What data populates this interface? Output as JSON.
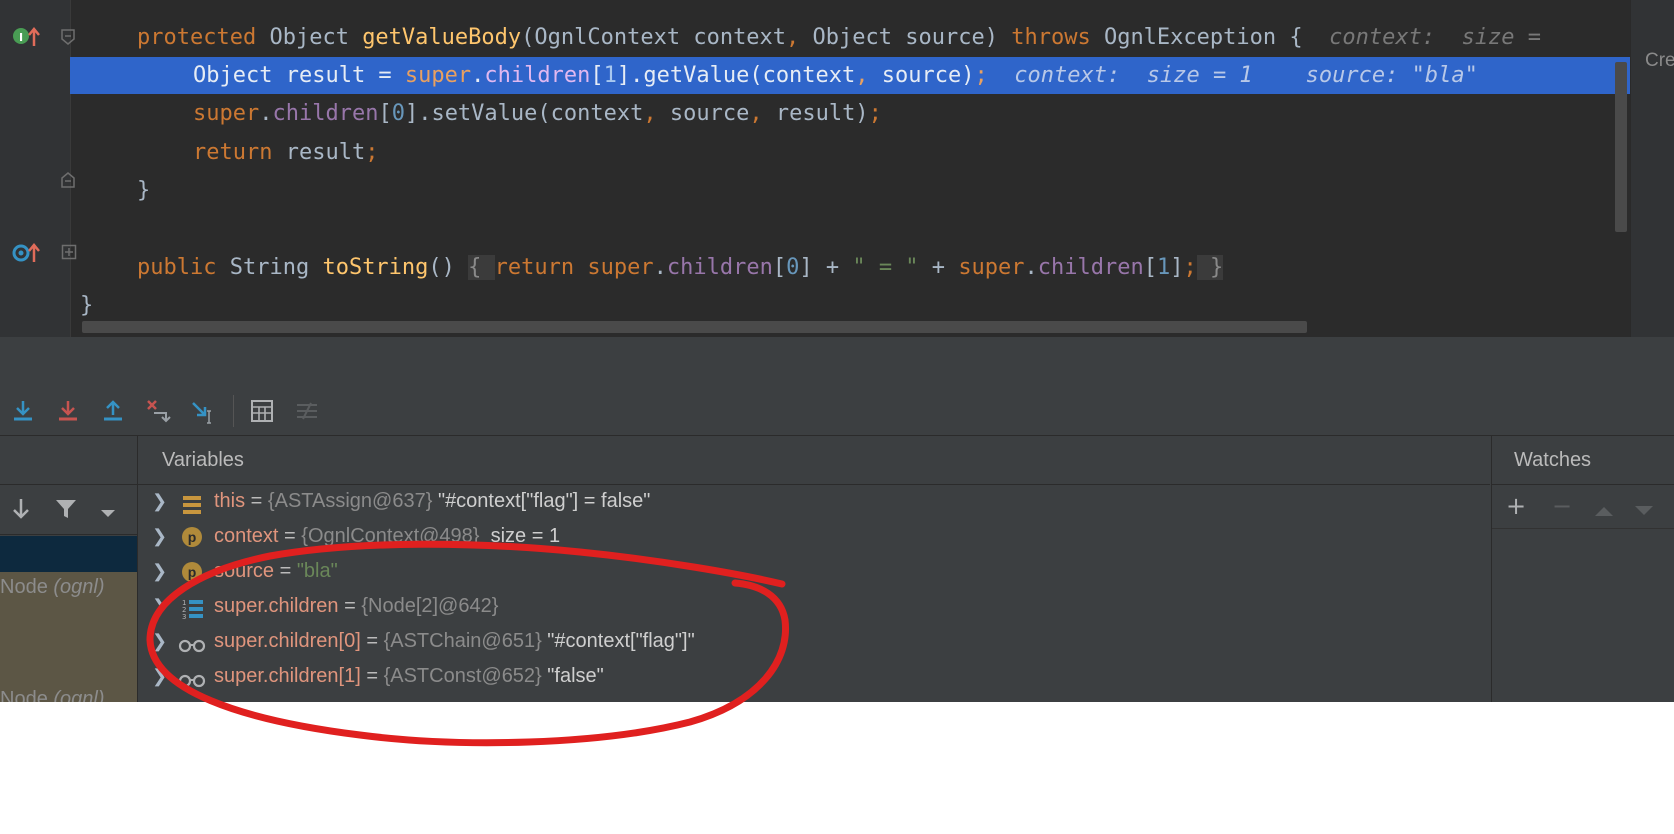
{
  "editor": {
    "line1": {
      "kw_protected": "protected",
      "type_object": " Object ",
      "method_name": "getValueBody",
      "params_a": "(OgnlContext context",
      "comma": ",",
      "params_b": " Object source) ",
      "kw_throws": "throws",
      "tail": " OgnlException {  ",
      "hint": "context:  size ="
    },
    "line2": {
      "pre": "Object result = ",
      "kw_super": "super",
      "dot": ".",
      "field": "children",
      "open": "[",
      "index": "1",
      "mid": "].getValue(context",
      "comma": ",",
      "post": " source)",
      "semi": ";",
      "hint_context": "context:  size = 1",
      "hint_source": "source: \"bla\""
    },
    "line3": {
      "kw_super": "super",
      "dot": ".",
      "field": "children",
      "open": "[",
      "index": "0",
      "mid": "].setValue(context",
      "comma1": ",",
      "mid2": " source",
      "comma2": ",",
      "post": " result)",
      "semi": ";"
    },
    "line4": {
      "kw_return": "return",
      "post": " result",
      "semi": ";"
    },
    "line5": {
      "brace": "}"
    },
    "line6": {
      "kw_public": "public",
      "type_string": " String ",
      "method_name": "toString",
      "parens": "() ",
      "fold_open": "{ ",
      "kw_return": "return ",
      "kw_super1": "super",
      "dot1": ".",
      "field1": "children",
      "open1": "[",
      "index1": "0",
      "close1": "] + ",
      "string_lit": "\" = \"",
      "plus": " + ",
      "kw_super2": "super",
      "dot2": ".",
      "field2": "children",
      "open2": "[",
      "index2": "1",
      "close2": "]",
      "semi": ";",
      "fold_close": " }"
    },
    "line7": {
      "brace": "}"
    },
    "right_edge_text": "Cre"
  },
  "debugger": {
    "variables_title": "Variables",
    "watches_title": "Watches",
    "frames": [
      {
        "name": "Node ",
        "pkg": "(ognl)"
      },
      {
        "name": "Node ",
        "pkg": "(ognl)"
      }
    ],
    "variables": [
      {
        "icon": "field-icon",
        "name": "this",
        "eq": " = ",
        "type": "{ASTAssign@637}",
        "value": " \"#context[\"flag\"] = false\""
      },
      {
        "icon": "param-icon",
        "name": "context",
        "eq": " = ",
        "type": "{OgnlContext@498}",
        "value": "  size = 1"
      },
      {
        "icon": "param-icon",
        "name": "source",
        "eq": " = ",
        "type": "",
        "value": "\"bla\""
      },
      {
        "icon": "array-icon",
        "name": "super.children",
        "eq": " = ",
        "type": "{Node[2]@642}",
        "value": ""
      },
      {
        "icon": "watch-glasses-icon",
        "name": "super.children[0]",
        "eq": " = ",
        "type": "{ASTChain@651}",
        "value": " \"#context[\"flag\"]\""
      },
      {
        "icon": "watch-glasses-icon",
        "name": "super.children[1]",
        "eq": " = ",
        "type": "{ASTConst@652}",
        "value": " \"false\""
      }
    ]
  },
  "colors": {
    "editor_bg": "#2b2b2b",
    "keyword": "#cc7832",
    "method": "#ffc66d",
    "field": "#9876aa",
    "number": "#6897bb",
    "string": "#6a8759",
    "highlight": "#2f65ca",
    "annotation": "#e0201f"
  }
}
